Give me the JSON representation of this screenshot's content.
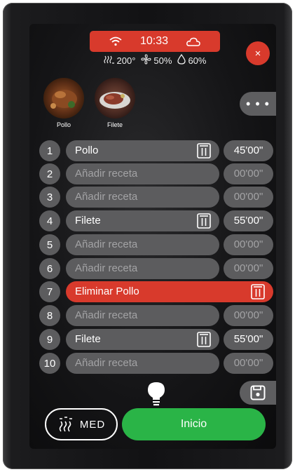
{
  "status": {
    "wifi_icon": "wifi-icon",
    "time": "10:33",
    "cloud_icon": "cloud-icon",
    "color": "#d83a2c"
  },
  "readouts": {
    "temperature": "200°",
    "fan": "50%",
    "humidity": "60%"
  },
  "favorites": [
    {
      "label": "Pollo"
    },
    {
      "label": "Filete"
    }
  ],
  "more_label": "• • •",
  "close_label": "×",
  "slots": [
    {
      "num": "1",
      "name": "Pollo",
      "time": "45'00\""
    },
    {
      "num": "2",
      "name": "Añadir receta",
      "time": "00'00\""
    },
    {
      "num": "3",
      "name": "Añadir receta",
      "time": "00'00\""
    },
    {
      "num": "4",
      "name": "Filete",
      "time": "55'00\""
    },
    {
      "num": "5",
      "name": "Añadir receta",
      "time": "00'00\""
    },
    {
      "num": "6",
      "name": "Añadir receta",
      "time": "00'00\""
    },
    {
      "num": "7",
      "name": "Eliminar Pollo",
      "time": ""
    },
    {
      "num": "8",
      "name": "Añadir receta",
      "time": "00'00\""
    },
    {
      "num": "9",
      "name": "Filete",
      "time": "55'00\""
    },
    {
      "num": "10",
      "name": "Añadir receta",
      "time": "00'00\""
    }
  ],
  "steam": {
    "label": "MED"
  },
  "start": {
    "label": "Inicio",
    "color": "#2ab447"
  }
}
